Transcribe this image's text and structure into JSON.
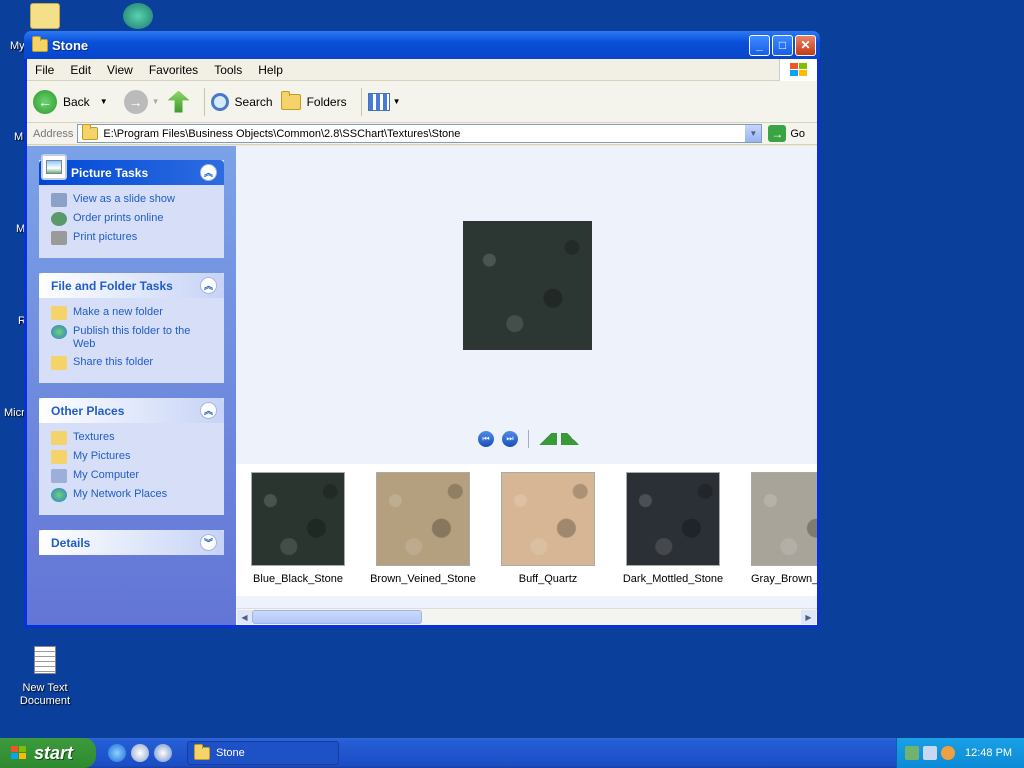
{
  "desktop": {
    "icons": [
      {
        "label": "New Text\nDocument"
      }
    ],
    "partial_labels": [
      "My",
      "M",
      "M",
      "R",
      "Micr"
    ]
  },
  "window": {
    "title": "Stone",
    "menu": [
      "File",
      "Edit",
      "View",
      "Favorites",
      "Tools",
      "Help"
    ],
    "toolbar": {
      "back": "Back",
      "search": "Search",
      "folders": "Folders"
    },
    "address": {
      "label": "Address",
      "path": "E:\\Program Files\\Business Objects\\Common\\2.8\\SSChart\\Textures\\Stone",
      "go": "Go"
    }
  },
  "taskpane": {
    "picture_tasks": {
      "title": "Picture Tasks",
      "items": [
        "View as a slide show",
        "Order prints online",
        "Print pictures"
      ]
    },
    "file_folder_tasks": {
      "title": "File and Folder Tasks",
      "items": [
        "Make a new folder",
        "Publish this folder to the Web",
        "Share this folder"
      ]
    },
    "other_places": {
      "title": "Other Places",
      "items": [
        "Textures",
        "My Pictures",
        "My Computer",
        "My Network Places"
      ]
    },
    "details": {
      "title": "Details"
    }
  },
  "filmstrip": {
    "thumbnails": [
      {
        "name": "Blue_Black_Stone",
        "color": "#2a3530"
      },
      {
        "name": "Brown_Veined_Stone",
        "color": "#b49f7e"
      },
      {
        "name": "Buff_Quartz",
        "color": "#d6b694"
      },
      {
        "name": "Dark_Mottled_Stone",
        "color": "#2b3036"
      },
      {
        "name": "Gray_Brown_S",
        "color": "#a8a49a"
      }
    ],
    "preview_color": "#2c3632"
  },
  "taskbar": {
    "start": "start",
    "task_button": "Stone",
    "clock": "12:48 PM"
  },
  "colors": {
    "desktop": "#0a3f9c",
    "taskpane_link": "#215dc6"
  }
}
